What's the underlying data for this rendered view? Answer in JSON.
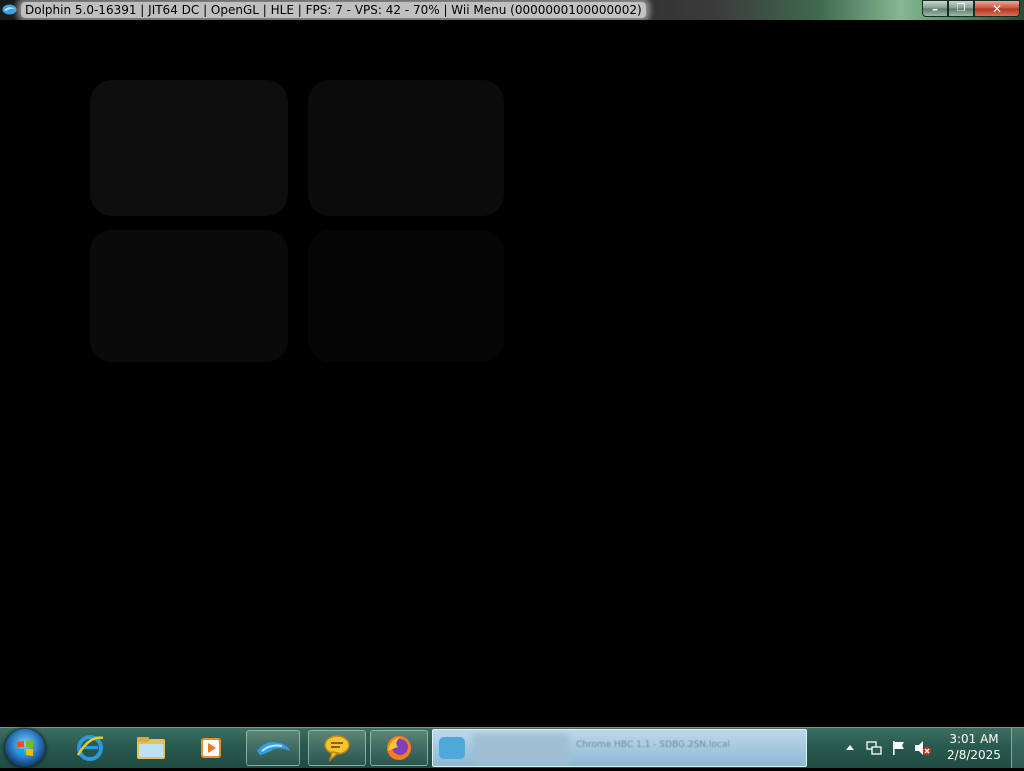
{
  "window": {
    "title": "Dolphin 5.0-16391 | JIT64 DC | OpenGL | HLE | FPS: 7 - VPS: 42 - 70% | Wii Menu (0000000100000002)",
    "icon": "dolphin-icon",
    "controls": {
      "minimize_label": "–",
      "maximize_label": "❐",
      "close_label": "✕"
    }
  },
  "render": {
    "content": "Wii Menu channel grid (dimmed)",
    "tile_color": "#0e0e0e"
  },
  "taskbar": {
    "start_icon": "windows-start-orb",
    "pinned": [
      {
        "name": "internet-explorer-icon"
      },
      {
        "name": "windows-explorer-icon"
      },
      {
        "name": "media-player-icon"
      },
      {
        "name": "dolphin-emulator-icon",
        "active": true
      },
      {
        "name": "chat-bubble-icon",
        "active": true
      },
      {
        "name": "firefox-icon",
        "active": true
      }
    ],
    "task_window_label": "Chrome HBC 1.1 - SDBG.2SN.local",
    "tray_icons": [
      "show-hidden-icons-icon",
      "network-icon",
      "action-center-flag-icon",
      "volume-muted-icon"
    ],
    "clock": {
      "time": "3:01 AM",
      "date": "2/8/2025"
    }
  },
  "colors": {
    "taskbar": "#2a5c50",
    "background": "#000000",
    "close_button": "#c7503b"
  }
}
